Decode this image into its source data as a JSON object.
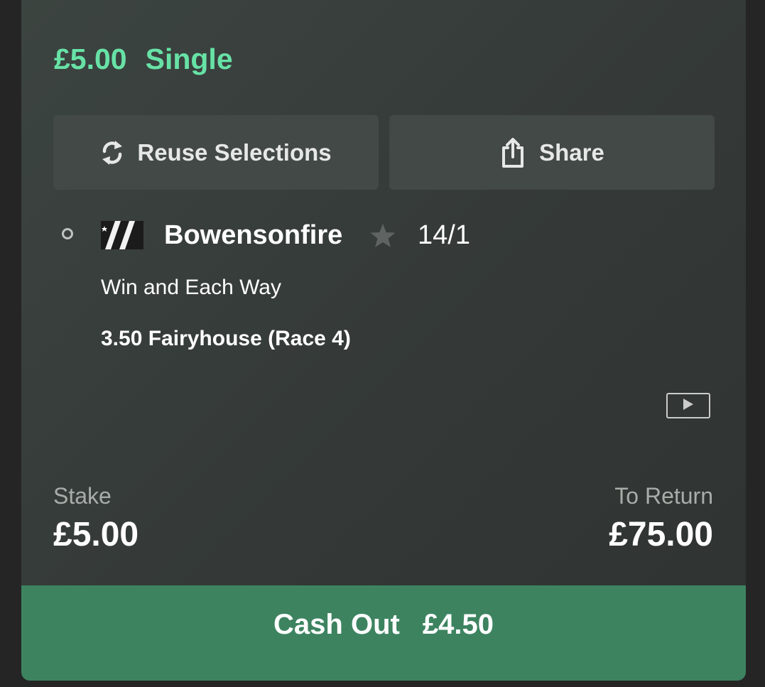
{
  "bet": {
    "stake_text": "£5.00",
    "type": "Single"
  },
  "actions": {
    "reuse_label": "Reuse Selections",
    "reuse_icon": "refresh-icon",
    "share_label": "Share",
    "share_icon": "share-icon"
  },
  "selection": {
    "runner": "Bowensonfire",
    "odds": "14/1",
    "market": "Win and Each Way",
    "event": "3.50 Fairyhouse (Race 4)",
    "status_icon": "radio-circle-icon",
    "silks_icon": "jockey-silks-icon",
    "favourite_icon": "star-icon",
    "video_icon": "video-play-icon"
  },
  "totals": {
    "stake_label": "Stake",
    "stake_value": "£5.00",
    "return_label": "To Return",
    "return_value": "£75.00"
  },
  "cashout": {
    "label": "Cash Out",
    "amount": "£4.50"
  },
  "colors": {
    "accent_green": "#67e2a6",
    "cashout_green": "#3d8360",
    "card_bg": "#343937",
    "button_bg": "#434946"
  }
}
